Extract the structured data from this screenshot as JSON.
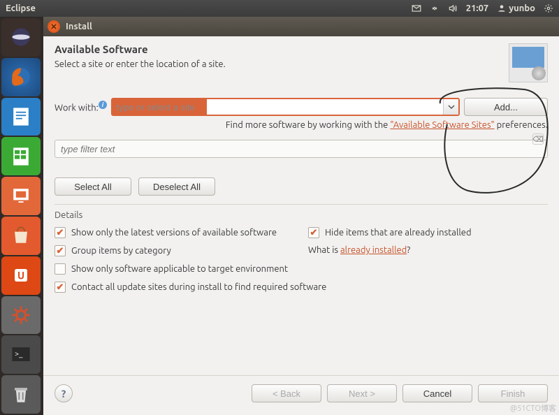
{
  "menubar": {
    "app_title": "Eclipse",
    "time": "21:07",
    "user": "yunbo"
  },
  "dialog": {
    "title": "Install",
    "heading": "Available Software",
    "subheading": "Select a site or enter the location of a site.",
    "work_with_label": "Work with:",
    "work_with_placeholder": "type or select a site",
    "add_button": "Add...",
    "hint_prefix": "Find more software by working with the ",
    "hint_link": "\"Available Software Sites\"",
    "hint_suffix": " preferences.",
    "filter_placeholder": "type filter text",
    "select_all": "Select All",
    "deselect_all": "Deselect All",
    "details_label": "Details",
    "options": {
      "show_latest": {
        "label": "Show only the latest versions of available software",
        "checked": true
      },
      "hide_installed": {
        "label": "Hide items that are already installed",
        "checked": true
      },
      "group_category": {
        "label": "Group items by category",
        "checked": true
      },
      "whatis_prefix": "What is ",
      "whatis_link": "already installed",
      "whatis_suffix": "?",
      "show_target_env": {
        "label": "Show only software applicable to target environment",
        "checked": false
      },
      "contact_sites": {
        "label": "Contact all update sites during install to find required software",
        "checked": true
      }
    },
    "footer": {
      "back": "< Back",
      "next": "Next >",
      "cancel": "Cancel",
      "finish": "Finish"
    }
  },
  "watermark": "@51CTO博客"
}
